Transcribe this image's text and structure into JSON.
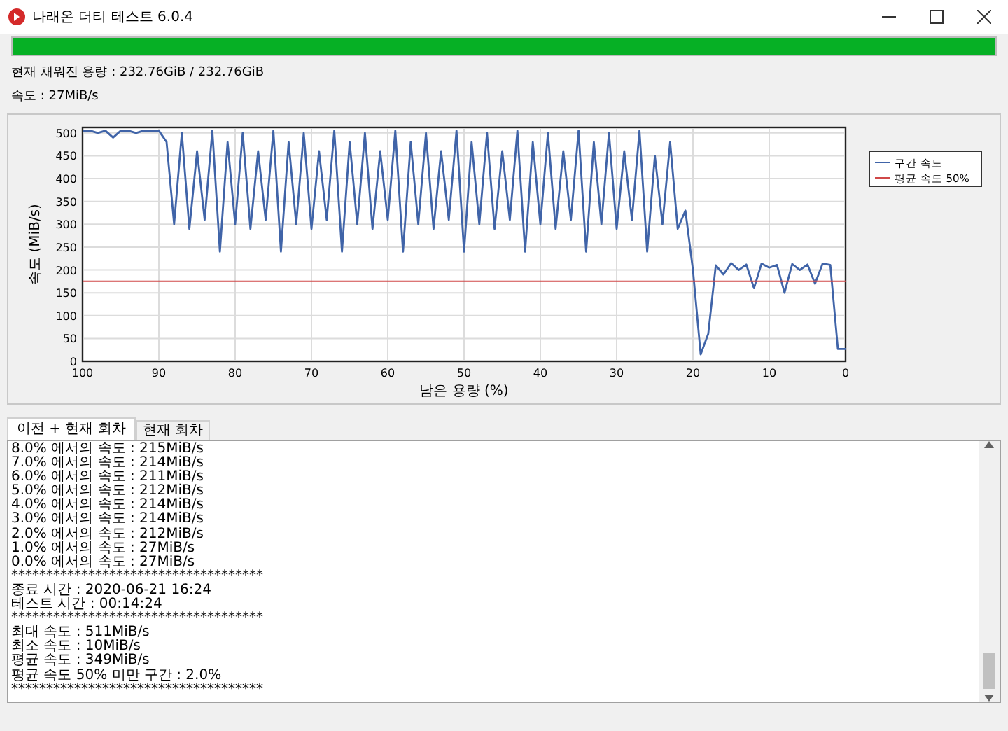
{
  "window": {
    "title": "나래온 더티 테스트 6.0.4"
  },
  "progress": {
    "level": 1
  },
  "status": {
    "filled": "현재 채워진 용량 : 232.76GiB / 232.76GiB",
    "speed": "속도 : 27MiB/s"
  },
  "chart": {
    "chart_data": {
      "type": "line",
      "xlabel": "남은 용량 (%)",
      "ylabel": "속도 (MiB/s)",
      "x": [
        100,
        99,
        98,
        97,
        96,
        95,
        94,
        93,
        92,
        91,
        90,
        89,
        88,
        87,
        86,
        85,
        84,
        83,
        82,
        81,
        80,
        79,
        78,
        77,
        76,
        75,
        74,
        73,
        72,
        71,
        70,
        69,
        68,
        67,
        66,
        65,
        64,
        63,
        62,
        61,
        60,
        59,
        58,
        57,
        56,
        55,
        54,
        53,
        52,
        51,
        50,
        49,
        48,
        47,
        46,
        45,
        44,
        43,
        42,
        41,
        40,
        39,
        38,
        37,
        36,
        35,
        34,
        33,
        32,
        31,
        30,
        29,
        28,
        27,
        26,
        25,
        24,
        23,
        22,
        21,
        20,
        19,
        18,
        17,
        16,
        15,
        14,
        13,
        12,
        11,
        10,
        9,
        8,
        7,
        6,
        5,
        4,
        3,
        2,
        1,
        0
      ],
      "series": [
        {
          "name": "구간 속도",
          "color": "#4064a8",
          "values": [
            505,
            505,
            500,
            505,
            490,
            505,
            505,
            500,
            505,
            505,
            505,
            480,
            300,
            500,
            290,
            460,
            310,
            505,
            240,
            480,
            300,
            500,
            290,
            460,
            310,
            505,
            240,
            480,
            300,
            500,
            290,
            460,
            310,
            505,
            240,
            480,
            300,
            500,
            290,
            460,
            310,
            505,
            240,
            480,
            300,
            500,
            290,
            460,
            310,
            505,
            240,
            480,
            300,
            500,
            290,
            460,
            310,
            505,
            240,
            480,
            300,
            500,
            290,
            460,
            310,
            505,
            240,
            480,
            300,
            500,
            290,
            460,
            310,
            505,
            240,
            450,
            300,
            480,
            290,
            330,
            200,
            15,
            60,
            210,
            190,
            215,
            200,
            212,
            160,
            214,
            205,
            211,
            150,
            213,
            200,
            212,
            170,
            214,
            211,
            27,
            27
          ]
        },
        {
          "name": "평균 속도 50%",
          "color": "#d04848",
          "values": [
            175,
            175,
            175,
            175,
            175,
            175,
            175,
            175,
            175,
            175,
            175,
            175,
            175,
            175,
            175,
            175,
            175,
            175,
            175,
            175,
            175,
            175,
            175,
            175,
            175,
            175,
            175,
            175,
            175,
            175,
            175,
            175,
            175,
            175,
            175,
            175,
            175,
            175,
            175,
            175,
            175,
            175,
            175,
            175,
            175,
            175,
            175,
            175,
            175,
            175,
            175,
            175,
            175,
            175,
            175,
            175,
            175,
            175,
            175,
            175,
            175,
            175,
            175,
            175,
            175,
            175,
            175,
            175,
            175,
            175,
            175,
            175,
            175,
            175,
            175,
            175,
            175,
            175,
            175,
            175,
            175,
            175,
            175,
            175,
            175,
            175,
            175,
            175,
            175,
            175,
            175,
            175,
            175,
            175,
            175,
            175,
            175,
            175,
            175,
            175,
            175
          ]
        }
      ],
      "grid": true,
      "legend": true,
      "xlim": [
        100,
        0
      ],
      "ylim": [
        0,
        512
      ],
      "xticks": [
        100,
        90,
        80,
        70,
        60,
        50,
        40,
        30,
        20,
        10,
        0
      ],
      "yticks": [
        0,
        50,
        100,
        150,
        200,
        250,
        300,
        350,
        400,
        450,
        500
      ]
    }
  },
  "tabs": [
    {
      "label": "이전 + 현재 회차",
      "selected": true
    },
    {
      "label": "현재 회차",
      "selected": false
    }
  ],
  "log_lines": [
    "8.0% 에서의 속도 : 215MiB/s",
    "7.0% 에서의 속도 : 214MiB/s",
    "6.0% 에서의 속도 : 211MiB/s",
    "5.0% 에서의 속도 : 212MiB/s",
    "4.0% 에서의 속도 : 214MiB/s",
    "3.0% 에서의 속도 : 214MiB/s",
    "2.0% 에서의 속도 : 212MiB/s",
    "1.0% 에서의 속도 : 27MiB/s",
    "0.0% 에서의 속도 : 27MiB/s",
    "************************************",
    "종료 시간 : 2020-06-21 16:24",
    "테스트 시간 : 00:14:24",
    "************************************",
    "최대 속도 : 511MiB/s",
    "최소 속도 : 10MiB/s",
    "평균 속도 : 349MiB/s",
    "평균 속도 50% 미만 구간 : 2.0%",
    "************************************"
  ]
}
